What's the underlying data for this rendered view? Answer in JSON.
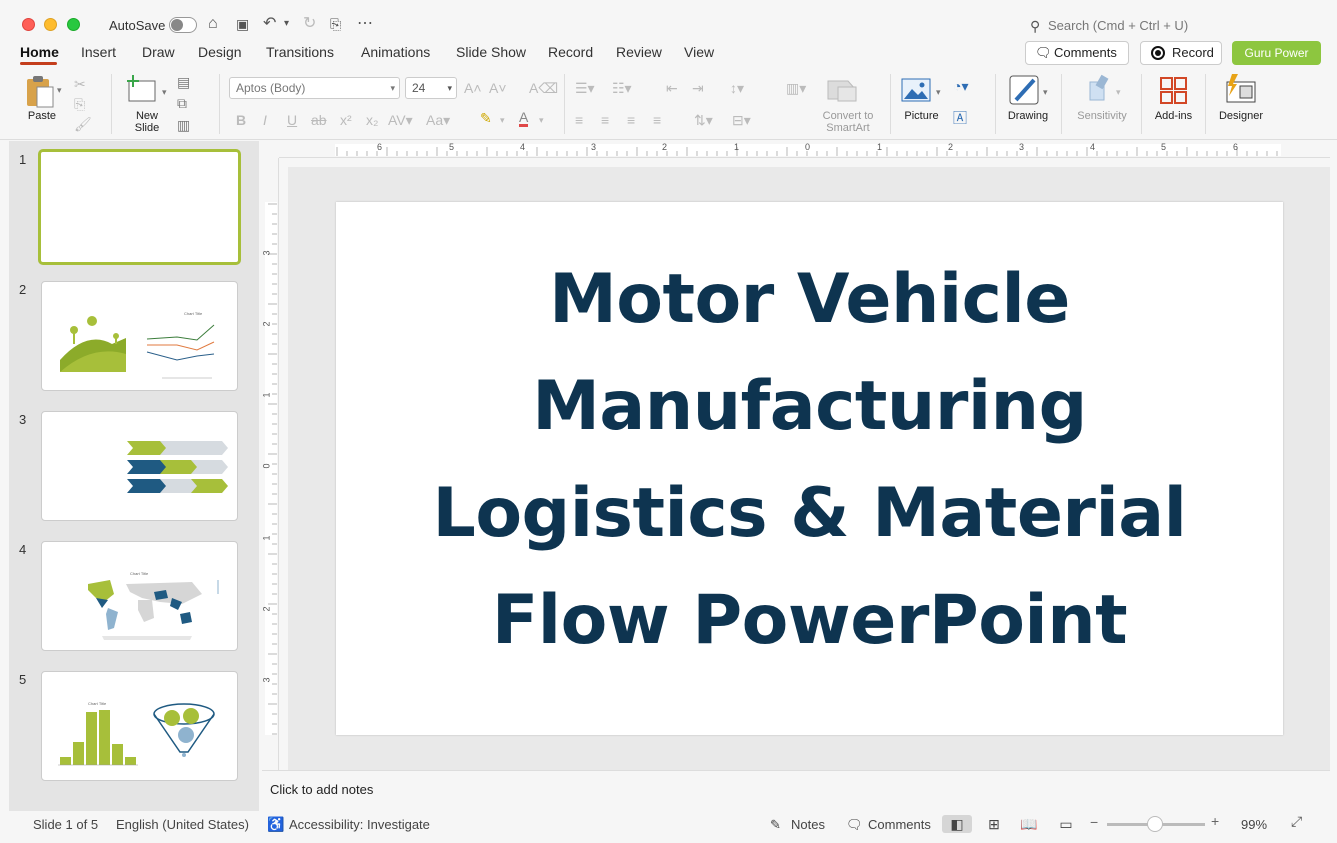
{
  "titlebar": {
    "autosave_label": "AutoSave",
    "search_placeholder": "Search (Cmd + Ctrl + U)"
  },
  "tabs": [
    {
      "label": "Home",
      "active": true
    },
    {
      "label": "Insert"
    },
    {
      "label": "Draw"
    },
    {
      "label": "Design"
    },
    {
      "label": "Transitions"
    },
    {
      "label": "Animations"
    },
    {
      "label": "Slide Show"
    },
    {
      "label": "Record"
    },
    {
      "label": "Review"
    },
    {
      "label": "View"
    }
  ],
  "actions": {
    "comments": "Comments",
    "record": "Record",
    "guru": "Guru Power"
  },
  "ribbon": {
    "paste": "Paste",
    "new_slide_line1": "New",
    "new_slide_line2": "Slide",
    "font": "Aptos (Body)",
    "size": "24",
    "smartart_line1": "Convert to",
    "smartart_line2": "SmartArt",
    "picture": "Picture",
    "drawing": "Drawing",
    "sensitivity": "Sensitivity",
    "addins": "Add-ins",
    "designer": "Designer"
  },
  "slides": [
    {
      "number": "1"
    },
    {
      "number": "2",
      "chart_title": "Chart Title"
    },
    {
      "number": "3"
    },
    {
      "number": "4",
      "chart_title": "Chart Title"
    },
    {
      "number": "5",
      "chart_title": "Chart Title"
    }
  ],
  "slide": {
    "title_lines": [
      "Motor Vehicle",
      "Manufacturing",
      "Logistics & Material",
      "Flow PowerPoint"
    ]
  },
  "ruler": {
    "top_ticks": [
      "6",
      "5",
      "4",
      "3",
      "2",
      "1",
      "0",
      "1",
      "2",
      "3",
      "4",
      "5",
      "6"
    ],
    "left_ticks": [
      "3",
      "2",
      "1",
      "0",
      "1",
      "2",
      "3"
    ]
  },
  "notes": {
    "placeholder": "Click to add notes"
  },
  "status": {
    "slide": "Slide 1 of 5",
    "language": "English (United States)",
    "accessibility": "Accessibility: Investigate",
    "notes": "Notes",
    "comments": "Comments",
    "zoom": "99%"
  },
  "colors": {
    "accent_green": "#a7bf3a",
    "title_navy": "#0e3450",
    "guru_green": "#8dc63f",
    "tab_underline": "#c43e1c"
  }
}
